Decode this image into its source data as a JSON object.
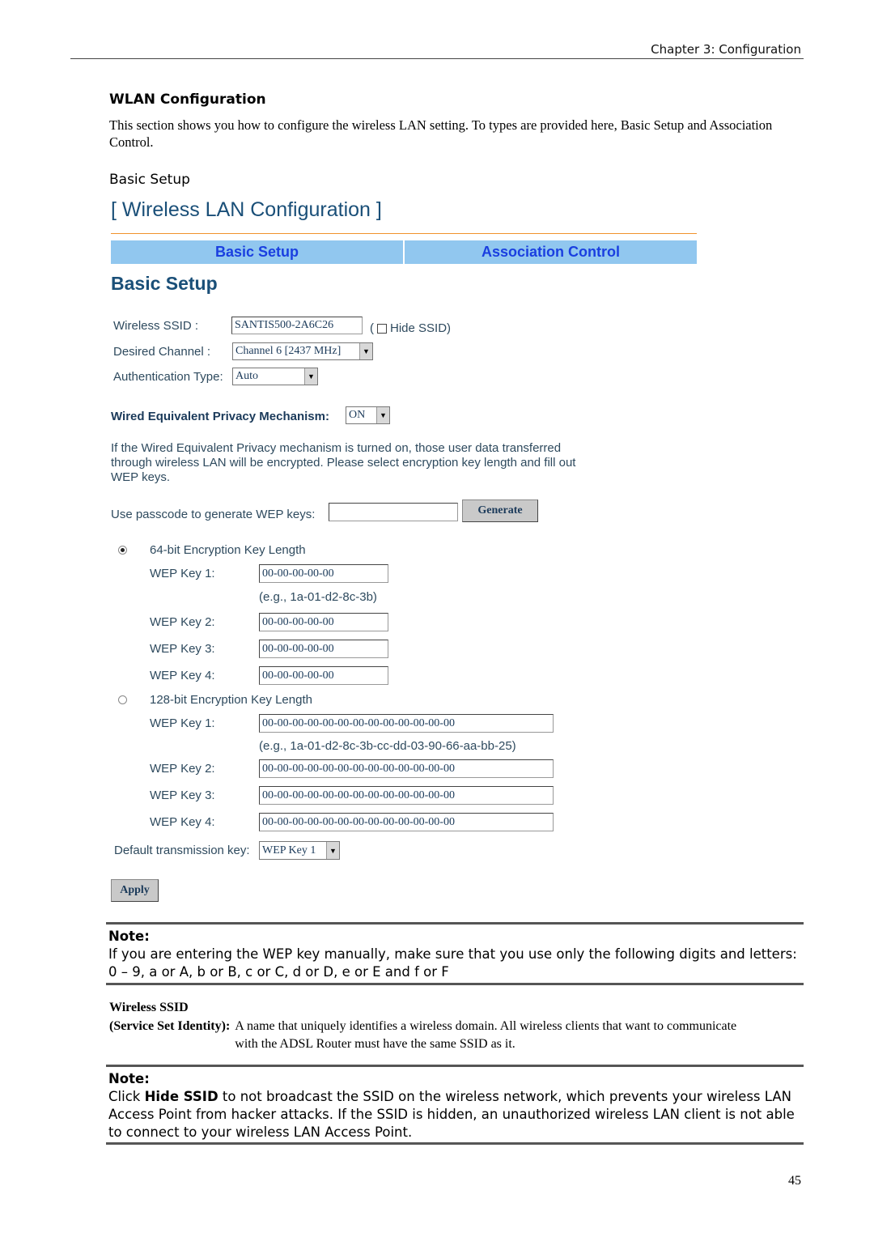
{
  "page_header": {
    "chapter": "Chapter 3: Configuration"
  },
  "section": {
    "heading": "WLAN Configuration",
    "intro": "This section shows you how to configure the wireless LAN setting. To types are provided here, Basic Setup and Association Control.",
    "subheading": "Basic Setup"
  },
  "ui": {
    "title": "[ Wireless LAN Configuration ]",
    "tabs": [
      {
        "label": "Basic Setup"
      },
      {
        "label": "Association Control"
      }
    ],
    "heading": "Basic Setup",
    "ssid": {
      "label": "Wireless SSID :",
      "value": "SANTIS500-2A6C26",
      "hide_open": "(",
      "hide_label": "Hide SSID)",
      "hide_checked": false
    },
    "channel": {
      "label": "Desired Channel :",
      "value": "Channel 6 [2437 MHz]"
    },
    "auth": {
      "label": "Authentication Type:",
      "value": "Auto"
    },
    "wep_mechanism": {
      "label": "Wired Equivalent Privacy Mechanism:",
      "value": "ON"
    },
    "description": "If the Wired Equivalent Privacy mechanism is turned on, those user data transferred through wireless LAN will be encrypted. Please select encryption key length and fill out WEP keys.",
    "passcode": {
      "label": "Use passcode to generate WEP keys:",
      "value": "",
      "button": "Generate"
    },
    "key64": {
      "label": "64-bit Encryption Key Length",
      "selected": true,
      "keys": [
        {
          "label": "WEP Key 1:",
          "value": "00-00-00-00-00"
        },
        {
          "label": "WEP Key 2:",
          "value": "00-00-00-00-00"
        },
        {
          "label": "WEP Key 3:",
          "value": "00-00-00-00-00"
        },
        {
          "label": "WEP Key 4:",
          "value": "00-00-00-00-00"
        }
      ],
      "example": "(e.g., 1a-01-d2-8c-3b)"
    },
    "key128": {
      "label": "128-bit Encryption Key Length",
      "selected": false,
      "keys": [
        {
          "label": "WEP Key 1:",
          "value": "00-00-00-00-00-00-00-00-00-00-00-00-00"
        },
        {
          "label": "WEP Key 2:",
          "value": "00-00-00-00-00-00-00-00-00-00-00-00-00"
        },
        {
          "label": "WEP Key 3:",
          "value": "00-00-00-00-00-00-00-00-00-00-00-00-00"
        },
        {
          "label": "WEP Key 4:",
          "value": "00-00-00-00-00-00-00-00-00-00-00-00-00"
        }
      ],
      "example": "(e.g., 1a-01-d2-8c-3b-cc-dd-03-90-66-aa-bb-25)"
    },
    "default_key": {
      "label": "Default transmission key:",
      "value": "WEP Key 1"
    },
    "apply_button": "Apply"
  },
  "note1": {
    "title": "Note:",
    "text": "If you are entering the WEP key manually, make sure that you use only the following digits and letters: 0 – 9, a or A, b or B, c or C, d or D, e or E and f or F"
  },
  "definition": {
    "term": "Wireless SSID",
    "subterm": "(Service Set Identity):",
    "text": "A name that uniquely identifies a wireless domain. All wireless clients that want to communicate with the ADSL Router must have the same SSID as it."
  },
  "note2": {
    "title": "Note:",
    "prefix": "Click ",
    "bold": "Hide SSID",
    "text": " to not broadcast the SSID on the wireless network, which prevents your wireless LAN Access Point from hacker attacks. If the SSID is hidden, an unauthorized wireless LAN client is not able to connect to your wireless LAN Access Point."
  },
  "page_number": "45"
}
